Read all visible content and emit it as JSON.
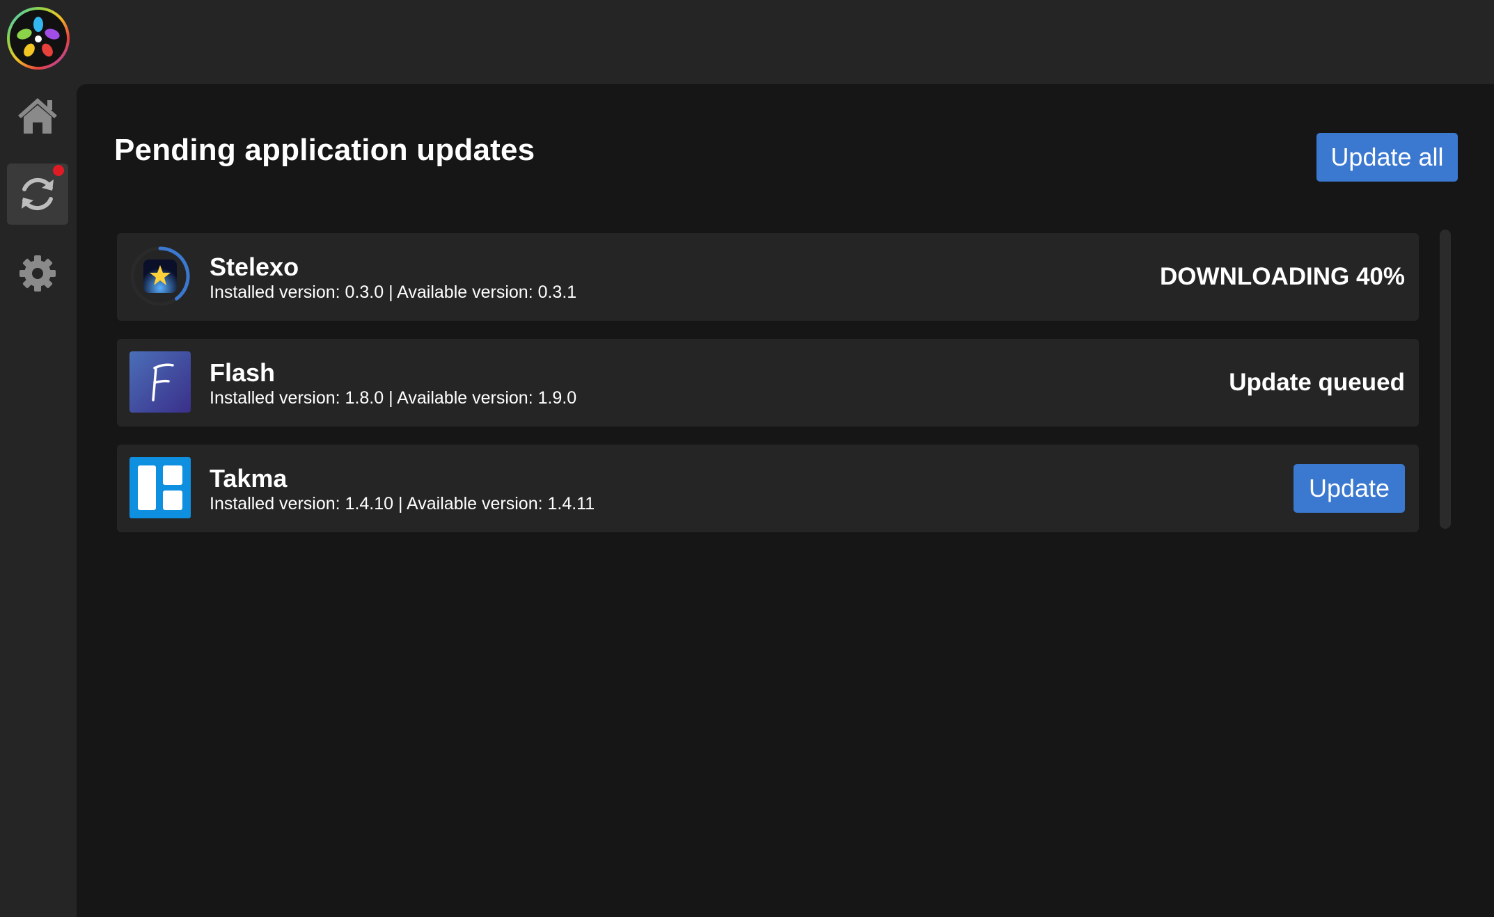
{
  "sidebar": {
    "logo_icon": "rainbow-star-logo-icon",
    "items": [
      {
        "id": "home",
        "icon": "home-icon",
        "active": false
      },
      {
        "id": "updates",
        "icon": "refresh-icon",
        "active": true,
        "notification": true
      },
      {
        "id": "settings",
        "icon": "gear-icon",
        "active": false
      }
    ],
    "notification_color": "#e01b24"
  },
  "main": {
    "title": "Pending application updates",
    "update_all_label": "Update all",
    "apps": [
      {
        "name": "Stelexo",
        "versions": "Installed version: 0.3.0 | Available version: 0.3.1",
        "icon": "stelexo-star-icon",
        "status": "DOWNLOADING 40%",
        "progress": 0.4
      },
      {
        "name": "Flash",
        "versions": "Installed version: 1.8.0 | Available version: 1.9.0",
        "icon": "flash-f-icon",
        "status": "Update queued"
      },
      {
        "name": "Takma",
        "versions": "Installed version: 1.4.10 | Available version: 1.4.11",
        "icon": "takma-board-icon",
        "button_label": "Update"
      }
    ]
  },
  "colors": {
    "accent": "#3b78d0",
    "background": "#252525",
    "panel": "#161616",
    "card": "#252525"
  }
}
